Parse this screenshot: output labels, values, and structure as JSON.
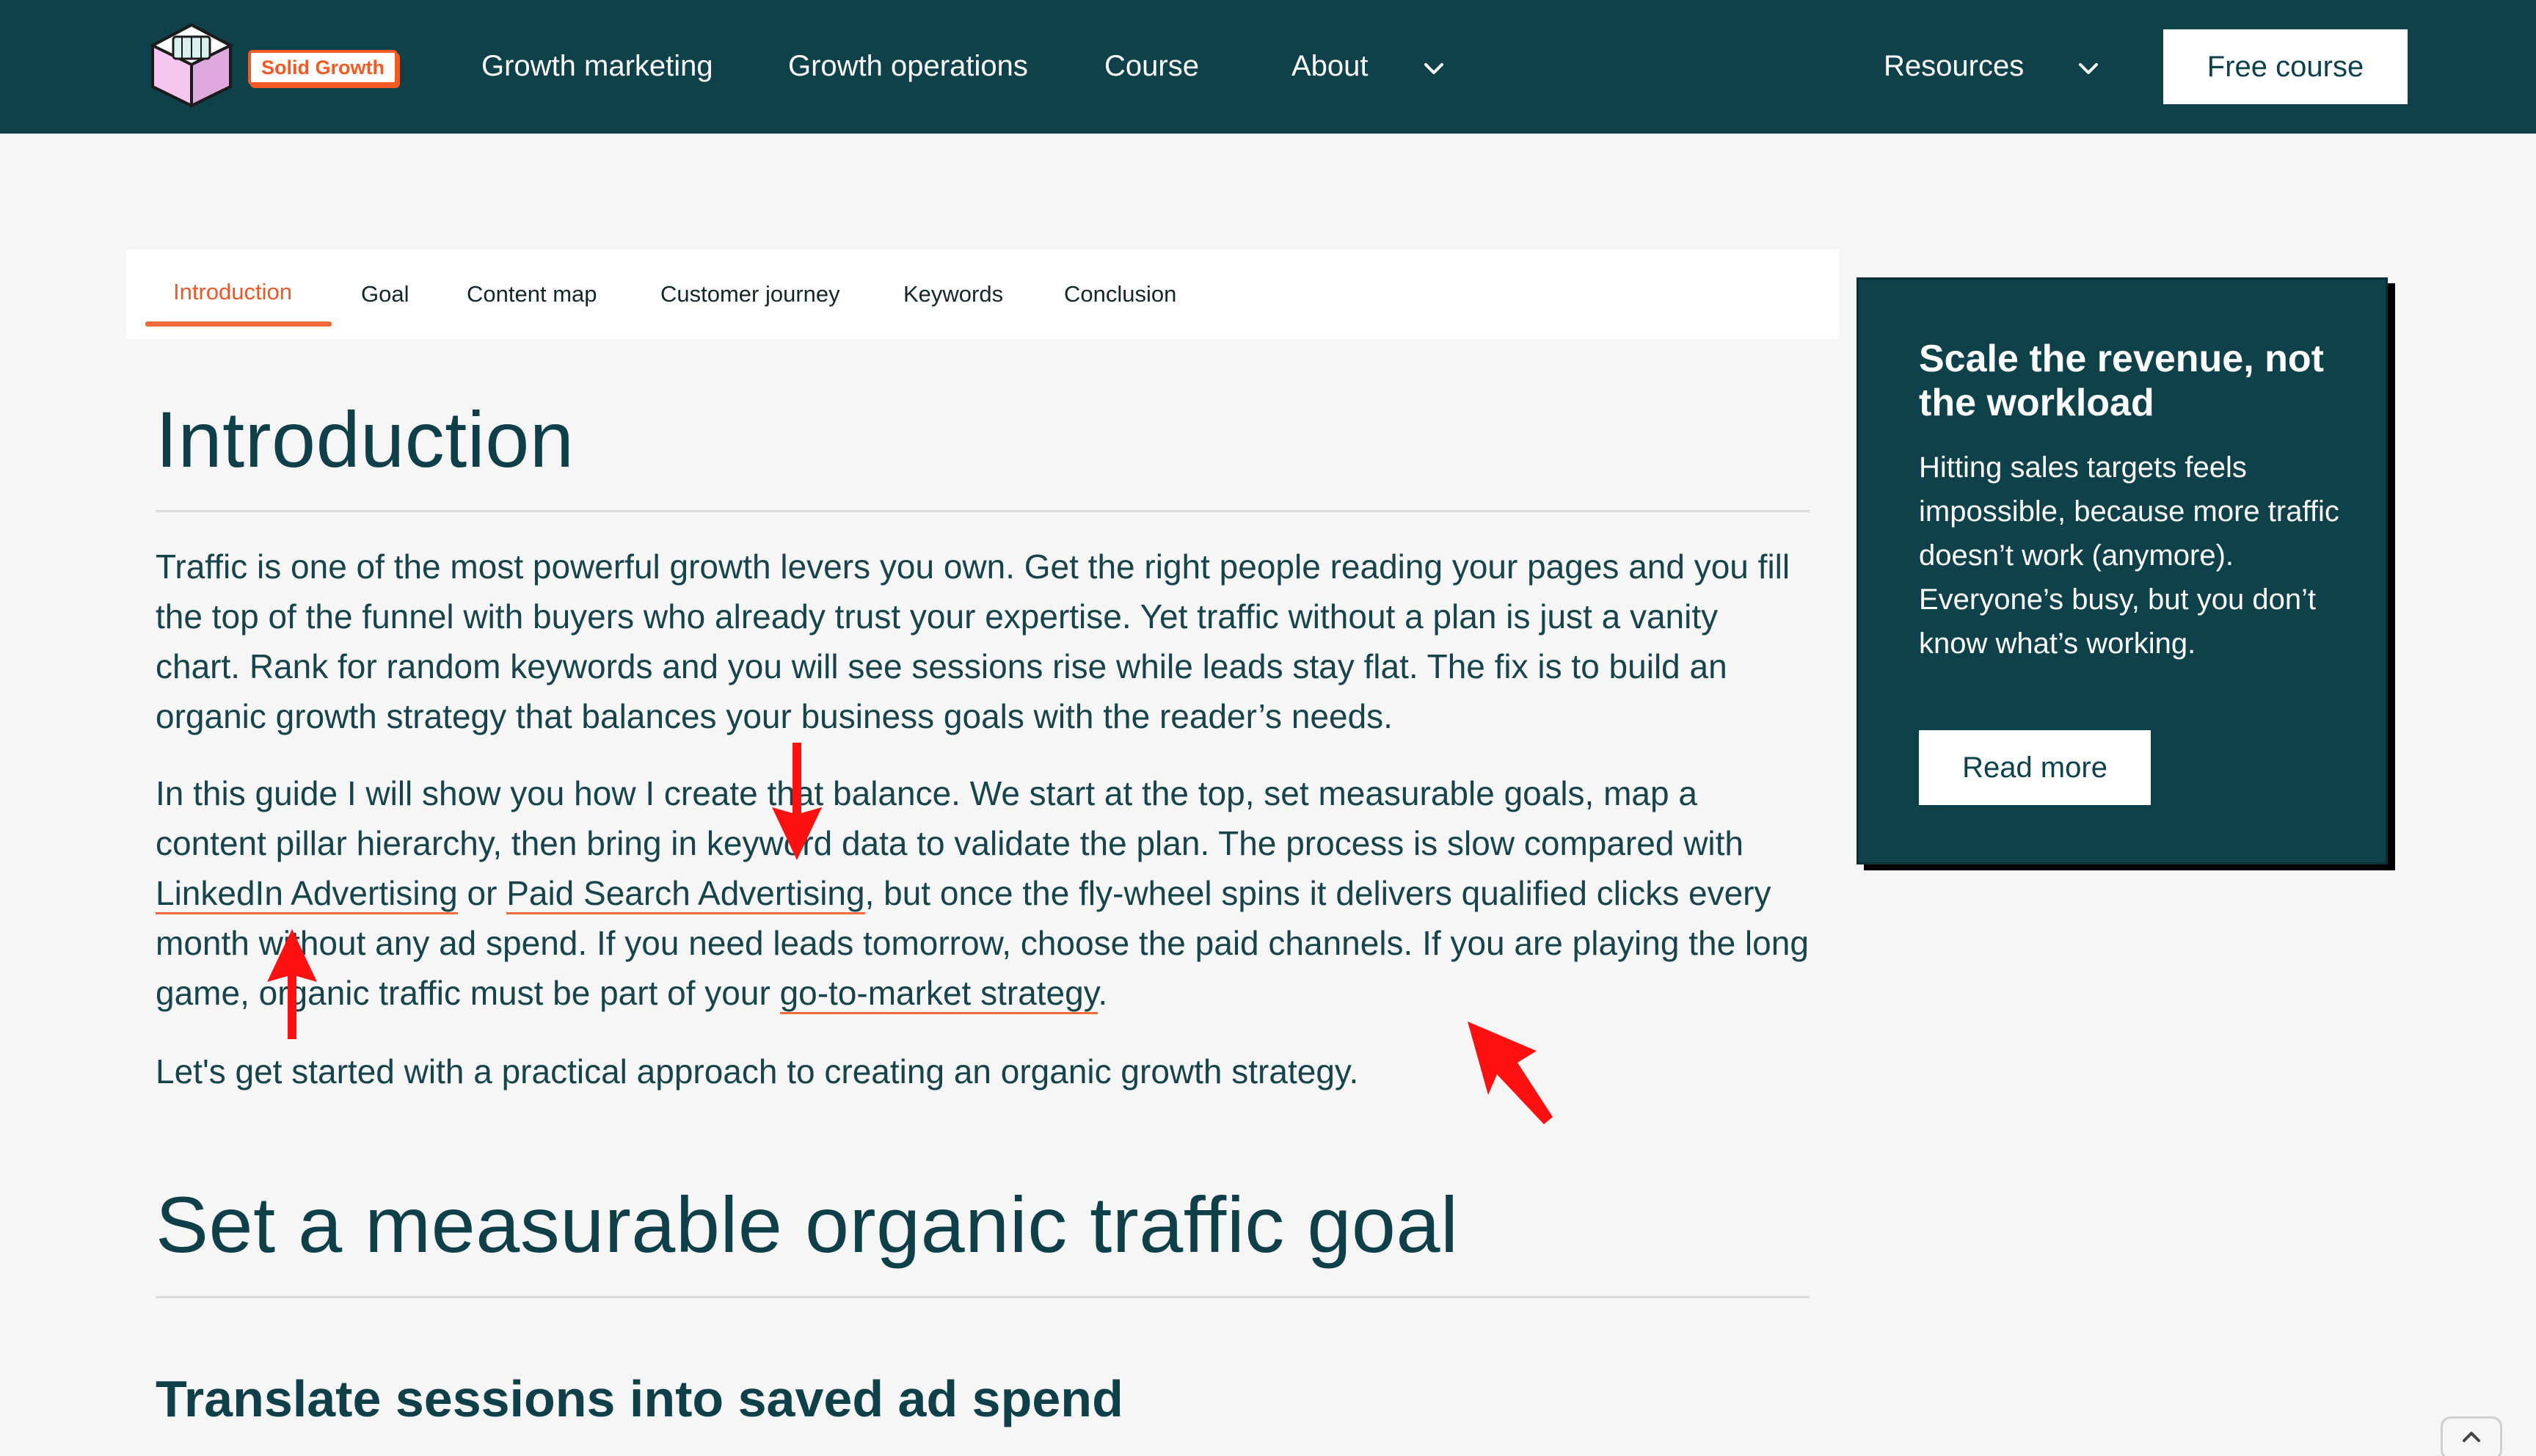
{
  "header": {
    "brand": "Solid Growth",
    "nav": [
      "Growth marketing",
      "Growth operations",
      "Course",
      "About"
    ],
    "resources": "Resources",
    "cta": "Free course"
  },
  "tabs": [
    "Introduction",
    "Goal",
    "Content map",
    "Customer journey",
    "Keywords",
    "Conclusion"
  ],
  "article": {
    "h1": "Introduction",
    "p1": "Traffic is one of the most powerful growth levers you own. Get the right people reading your pages and you fill the top of the funnel with buyers who already trust your expertise. Yet traffic without a plan is just a vanity chart. Rank for random keywords and you will see sessions rise while leads stay flat. The fix is to build an organic growth strategy that balances your business goals with the reader’s needs.",
    "p2": {
      "a": "In this guide I will show you how I create that balance. We start at the top, set measurable goals, map a content pillar hierarchy, then bring in keyword data to validate the plan. The process is slow compared with ",
      "link1": "LinkedIn Advertising",
      "b": " or ",
      "link2": "Paid Search Advertising",
      "c": ", but once the fly-wheel spins it delivers qualified clicks every month without any ad spend. If you need leads tomorrow, choose the paid channels. If you are playing the long game, organic traffic must be part of your ",
      "link3": "go-to-market strategy",
      "d": "."
    },
    "p3": "Let's get started with a practical approach to creating an organic growth strategy.",
    "h2": "Set a measurable organic traffic goal",
    "h3": "Translate sessions into saved ad spend"
  },
  "sidebar": {
    "title": "Scale the revenue, not the workload",
    "body": "Hitting sales targets feels impossible, because more traffic doesn’t work (anymore). Everyone’s busy, but you don’t know what’s working.",
    "button": "Read more"
  },
  "colors": {
    "header_bg": "#0e414a",
    "accent": "#f06b3b",
    "annotation": "#ff0000"
  }
}
